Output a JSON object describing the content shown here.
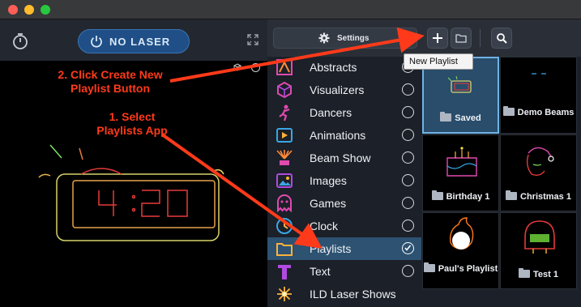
{
  "left_panel": {
    "laser_button": "NO LASER"
  },
  "middle_panel": {
    "settings_label": "Settings",
    "apps": [
      {
        "label": "Abstracts",
        "icon": "abstracts-icon",
        "selected": false
      },
      {
        "label": "Visualizers",
        "icon": "visualizers-icon",
        "selected": false
      },
      {
        "label": "Dancers",
        "icon": "dancers-icon",
        "selected": false
      },
      {
        "label": "Animations",
        "icon": "animations-icon",
        "selected": false
      },
      {
        "label": "Beam Show",
        "icon": "beam-show-icon",
        "selected": false
      },
      {
        "label": "Images",
        "icon": "images-icon",
        "selected": false
      },
      {
        "label": "Games",
        "icon": "games-icon",
        "selected": false
      },
      {
        "label": "Clock",
        "icon": "clock-icon",
        "selected": false
      },
      {
        "label": "Playlists",
        "icon": "playlists-icon",
        "selected": true
      },
      {
        "label": "Text",
        "icon": "text-icon",
        "selected": false
      },
      {
        "label": "ILD Laser Shows",
        "icon": "ild-icon",
        "selected": false
      }
    ]
  },
  "right_panel": {
    "tooltip": "New Playlist",
    "playlists": [
      {
        "label": "Saved",
        "selected": true
      },
      {
        "label": "Demo Beams",
        "selected": false
      },
      {
        "label": "Birthday 1",
        "selected": false
      },
      {
        "label": "Christmas 1",
        "selected": false
      },
      {
        "label": "Paul's Playlist",
        "selected": false
      },
      {
        "label": "Test 1",
        "selected": false
      }
    ]
  },
  "annotations": {
    "step2": "2. Click Create New Playlist Button",
    "step1": "1. Select Playlists App"
  },
  "colors": {
    "annotation": "#ff3a1a",
    "accent_blue": "#1f4f86",
    "selected_row": "#2d5272",
    "saved_tile": "#294d6b"
  }
}
